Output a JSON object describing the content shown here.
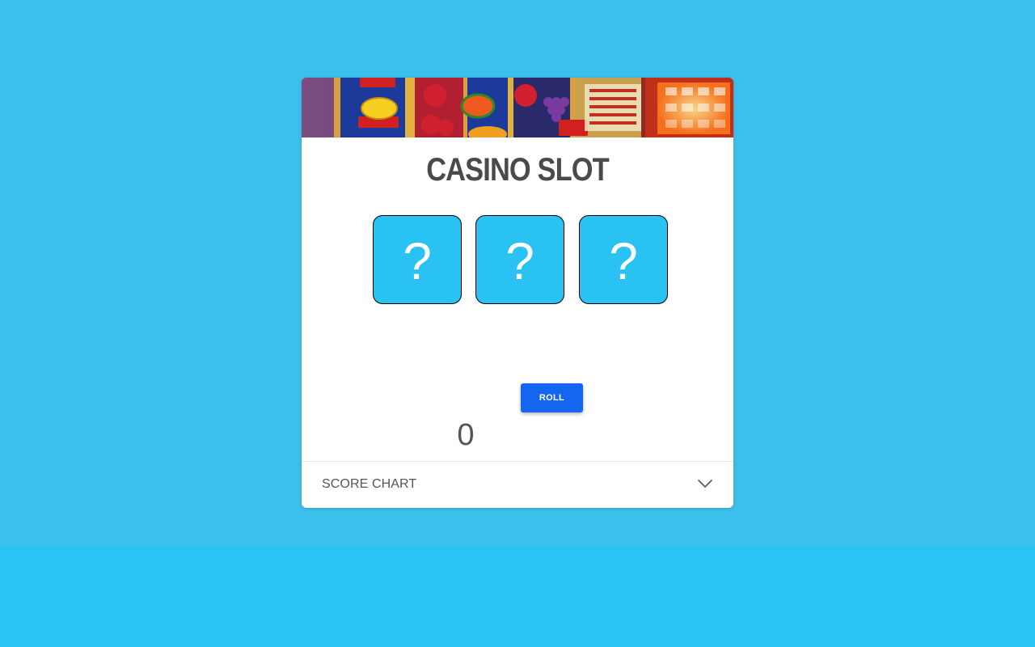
{
  "game": {
    "title": "CASINO SLOT",
    "reels": [
      "?",
      "?",
      "?"
    ],
    "roll_label": "ROLL",
    "score": "0",
    "score_chart_label": "SCORE CHART"
  },
  "colors": {
    "page_background": "#3cc0ec",
    "reel_background": "#29c2f2",
    "button_background": "#1565f0",
    "title_text": "#4a4a4a"
  },
  "icons": {
    "expand": "chevron-down-icon",
    "banner": "slot-machine-banner-image"
  }
}
